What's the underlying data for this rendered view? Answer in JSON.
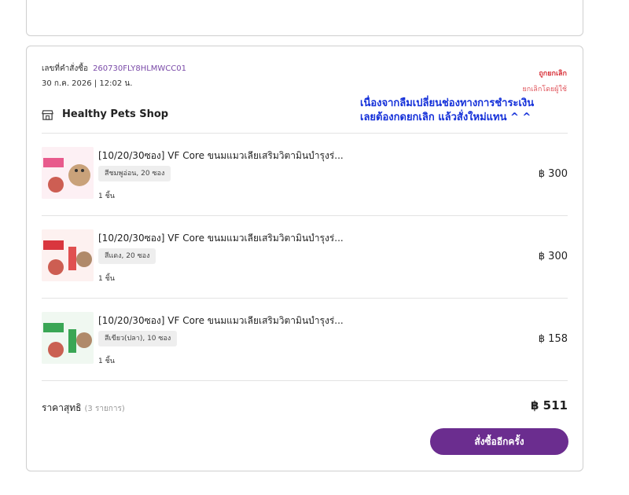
{
  "order": {
    "number_label": "เลขที่คำสั่งซื้อ",
    "number_value": "260730FLY8HLMWCC01",
    "date": "30 ก.ค. 2026 | 12:02 น.",
    "status": "ถูกยกเลิก",
    "cancelled_by": "ยกเลิกโดยผู้ใช้",
    "shop_name": "Healthy Pets Shop",
    "icons": {
      "shop": "store-icon"
    }
  },
  "annotation": {
    "line1": "เนื่องจากลืมเปลี่ยนช่องทางการชำระเงิน",
    "line2": "เลยต้องกดยกเลิก  แล้วสั่งใหม่แทน  ^ ^"
  },
  "items": [
    {
      "title": "[10/20/30ซอง] VF Core ขนมแมวเลียเสริมวิตามินบำรุงร่...",
      "variant": "สีชมพูอ่อน, 20 ซอง",
      "qty": "1 ชิ้น",
      "price": "฿ 300",
      "color": "#e85a8c"
    },
    {
      "title": "[10/20/30ซอง] VF Core ขนมแมวเลียเสริมวิตามินบำรุงร่...",
      "variant": "สีแดง, 20 ซอง",
      "qty": "1 ชิ้น",
      "price": "฿ 300",
      "color": "#d9363e"
    },
    {
      "title": "[10/20/30ซอง] VF Core ขนมแมวเลียเสริมวิตามินบำรุงร่...",
      "variant": "สีเขียว(ปลา), 10 ซอง",
      "qty": "1 ชิ้น",
      "price": "฿ 158",
      "color": "#3aa655"
    }
  ],
  "summary": {
    "total_label": "ราคาสุทธิ",
    "total_count": "(3 รายการ)",
    "total_value": "฿ 511"
  },
  "actions": {
    "reorder_label": "สั่งซื้ออีกครั้ง"
  },
  "colors": {
    "accent": "#6b2d8f",
    "cancel": "#d9363e",
    "annotation": "#1430d9"
  }
}
